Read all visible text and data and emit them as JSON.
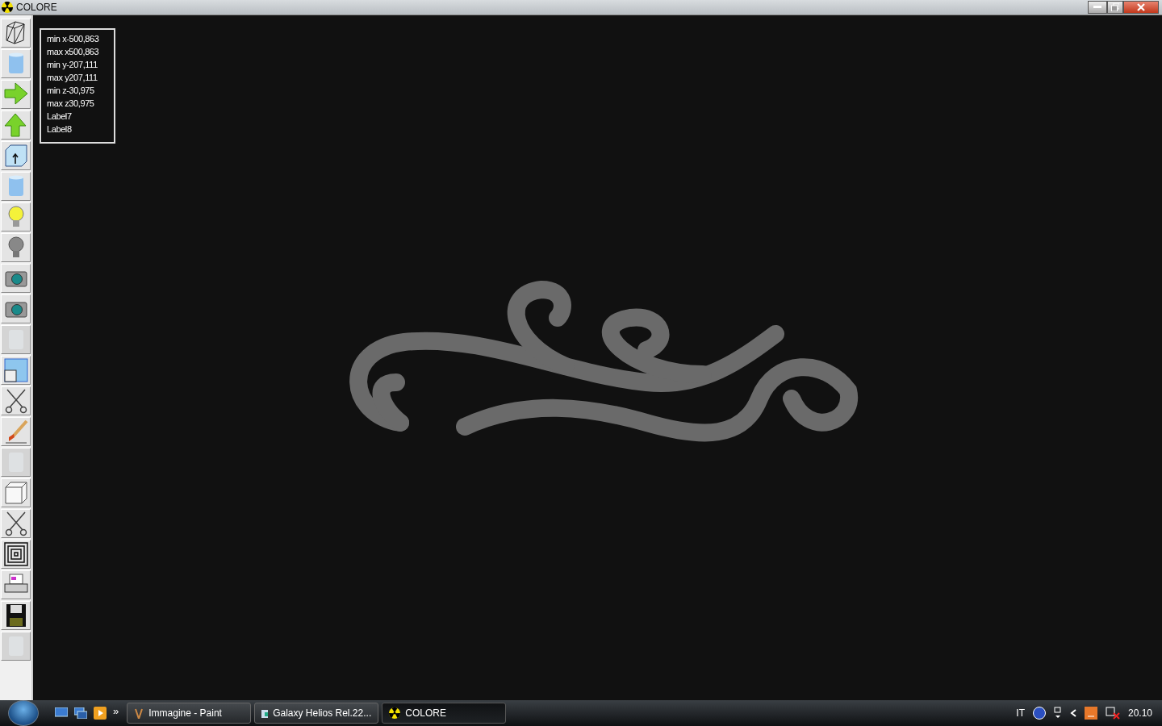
{
  "window": {
    "title": "COLORE"
  },
  "tools": [
    {
      "kind": "wireframe",
      "disabled": false
    },
    {
      "kind": "cylinder",
      "disabled": false
    },
    {
      "kind": "arrow-right",
      "disabled": false
    },
    {
      "kind": "arrow-up",
      "disabled": false
    },
    {
      "kind": "box-arrow",
      "disabled": false
    },
    {
      "kind": "cylinder",
      "disabled": false
    },
    {
      "kind": "bulb-on",
      "disabled": false
    },
    {
      "kind": "bulb-off",
      "disabled": false
    },
    {
      "kind": "camera",
      "disabled": false
    },
    {
      "kind": "camera",
      "disabled": false
    },
    {
      "kind": "blank",
      "disabled": true
    },
    {
      "kind": "window",
      "disabled": false
    },
    {
      "kind": "scissors",
      "disabled": false
    },
    {
      "kind": "brush",
      "disabled": false
    },
    {
      "kind": "blank",
      "disabled": true
    },
    {
      "kind": "cube",
      "disabled": false
    },
    {
      "kind": "scissors",
      "disabled": false
    },
    {
      "kind": "squares",
      "disabled": false
    },
    {
      "kind": "printer",
      "disabled": false
    },
    {
      "kind": "floppy",
      "disabled": false
    },
    {
      "kind": "blank",
      "disabled": true
    }
  ],
  "info_labels": [
    "min x-500,863",
    "max x500,863",
    "min y-207,111",
    "max y207,111",
    "min z-30,975",
    "max z30,975",
    "Label7",
    "Label8"
  ],
  "taskbar": {
    "more": "»",
    "tasks": [
      {
        "label": "Immagine - Paint",
        "kind": "paint",
        "selected": false
      },
      {
        "label": "Galaxy Helios  Rel.22...",
        "kind": "folder",
        "selected": false
      },
      {
        "label": "COLORE",
        "kind": "colore",
        "selected": true
      }
    ],
    "language": "IT",
    "clock": "20.10"
  }
}
